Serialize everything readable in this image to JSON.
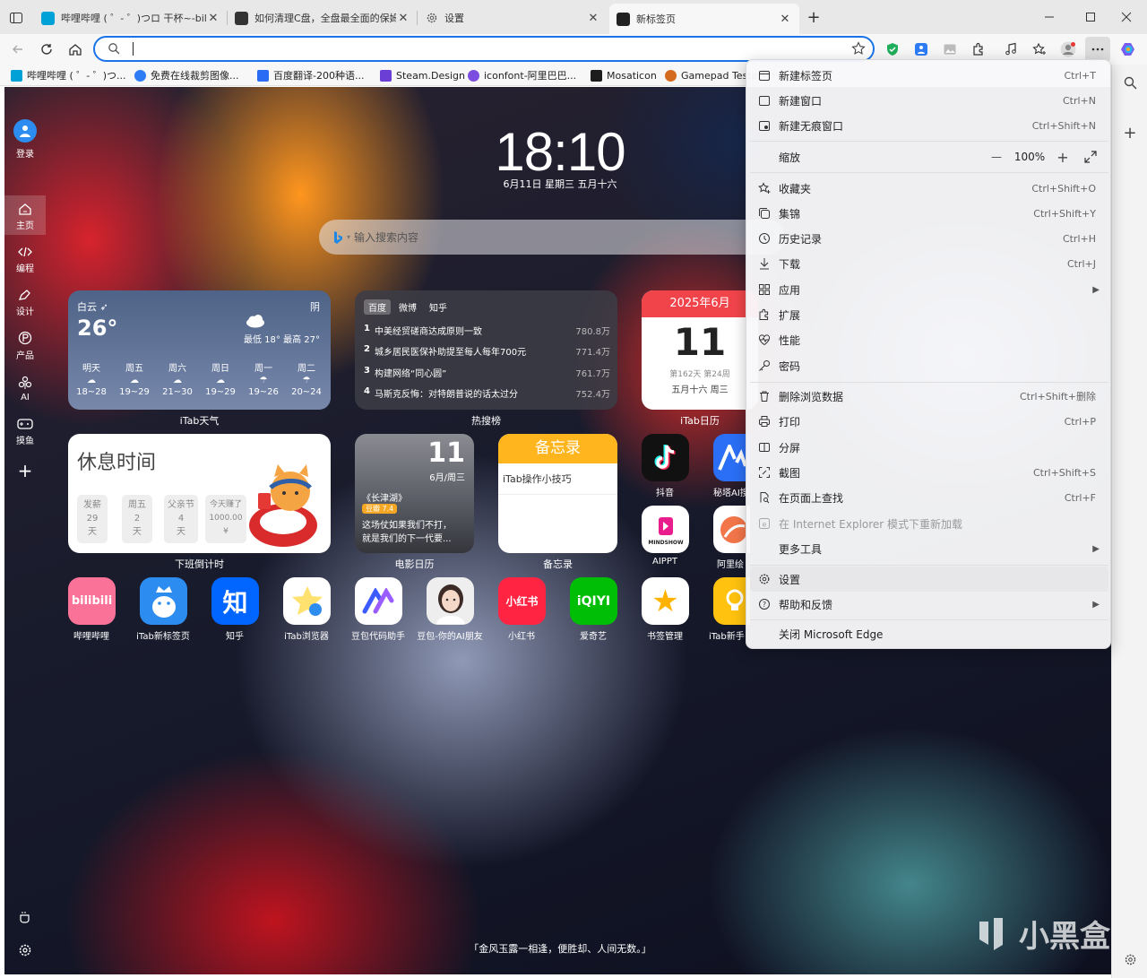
{
  "tabs": [
    {
      "title": "哔哩哔哩 ( ゜- ゜)つロ 干杯~-bilibili",
      "favicon_color": "#00a1d6"
    },
    {
      "title": "如何清理C盘，全盘最全面的保姆级",
      "favicon_color": "#333333"
    },
    {
      "title": "设置",
      "favicon_color": "#555555"
    },
    {
      "title": "新标签页",
      "favicon_color": "#222222"
    }
  ],
  "address_bar": {
    "value": ""
  },
  "bookmarks": [
    {
      "label": "哔哩哔哩 ( ゜- ゜)つ...",
      "color": "#00a1d6"
    },
    {
      "label": "免费在线裁剪图像...",
      "color": "#2d7cf6"
    },
    {
      "label": "百度翻译-200种语...",
      "color": "#2a6df4"
    },
    {
      "label": "Steam.Design",
      "color": "#6b3fd6"
    },
    {
      "label": "iconfont-阿里巴巴...",
      "color": "#7b4ee0"
    },
    {
      "label": "Mosaticon",
      "color": "#1d1d1d"
    },
    {
      "label": "Gamepad Teste",
      "color": "#d46a1e"
    }
  ],
  "sidebar": {
    "login": "登录",
    "items": [
      {
        "label": "主页",
        "icon": "home-icon"
      },
      {
        "label": "编程",
        "icon": "code-icon"
      },
      {
        "label": "设计",
        "icon": "pen-icon"
      },
      {
        "label": "产品",
        "icon": "p-icon"
      },
      {
        "label": "AI",
        "icon": "ai-icon"
      },
      {
        "label": "摸鱼",
        "icon": "gamepad-icon"
      }
    ]
  },
  "clock": {
    "time": "18:10",
    "date": "6月11日  星期三  五月十六"
  },
  "search": {
    "placeholder": "输入搜索内容"
  },
  "weather": {
    "city": "白云",
    "temp": "26°",
    "cond": "阴",
    "range": "最低 18° 最高 27°",
    "forecast": [
      {
        "day": "明天",
        "range": "18~28"
      },
      {
        "day": "周五",
        "range": "19~29"
      },
      {
        "day": "周六",
        "range": "21~30"
      },
      {
        "day": "周日",
        "range": "19~29"
      },
      {
        "day": "周一",
        "range": "19~26"
      },
      {
        "day": "周二",
        "range": "20~24"
      }
    ],
    "label": "iTab天气"
  },
  "hot": {
    "tabs": [
      "百度",
      "微博",
      "知乎"
    ],
    "items": [
      {
        "n": "1",
        "title": "中美经贸磋商达成原则一致",
        "value": "780.8万"
      },
      {
        "n": "2",
        "title": "城乡居民医保补助提至每人每年700元",
        "value": "771.4万"
      },
      {
        "n": "3",
        "title": "构建网络“同心圆”",
        "value": "761.7万"
      },
      {
        "n": "4",
        "title": "马斯克反悔：对特朗普说的话太过分",
        "value": "752.4万"
      }
    ],
    "label": "热搜榜"
  },
  "calendar": {
    "header": "2025年6月",
    "day": "11",
    "week": "第162天 第24周",
    "lunar": "五月十六 周三",
    "label": "iTab日历"
  },
  "countdown": {
    "title": "休息时间",
    "cells": [
      {
        "top": "发薪",
        "mid": "29",
        "bot": "天"
      },
      {
        "top": "周五",
        "mid": "2",
        "bot": "天"
      },
      {
        "top": "父亲节",
        "mid": "4",
        "bot": "天"
      },
      {
        "top": "今天赚了",
        "mid": "1000.00",
        "bot": "¥"
      }
    ],
    "label": "下班倒计时"
  },
  "movie": {
    "day": "11",
    "date": "6月/周三",
    "title": "《长津湖》",
    "score": "豆瓣 7.4",
    "desc1": "这场仗如果我们不打，",
    "desc2": "就是我们的下一代要...",
    "label": "电影日历"
  },
  "memo": {
    "header": "备忘录",
    "item": "iTab操作小技巧",
    "label": "备忘录"
  },
  "apps_right": [
    {
      "label": "抖音",
      "bg": "#111111"
    },
    {
      "label": "秘塔AI搜",
      "bg": "#2b6ff6"
    },
    {
      "label": "AIPPT",
      "bg": "#ffffff"
    },
    {
      "label": "阿里绘",
      "bg": "#ffffff"
    }
  ],
  "apps_bottom": [
    {
      "label": "哔哩哔哩",
      "bg": "#fb7299",
      "glyph": "bilibili"
    },
    {
      "label": "iTab新标签页",
      "bg": "#2d8cf0",
      "glyph": ""
    },
    {
      "label": "知乎",
      "bg": "#0066ff",
      "glyph": "知"
    },
    {
      "label": "iTab浏览器",
      "bg": "#ffffff",
      "glyph": ""
    },
    {
      "label": "豆包代码助手",
      "bg": "#ffffff",
      "glyph": ""
    },
    {
      "label": "豆包-你的AI朋友",
      "bg": "#eeeeee",
      "glyph": ""
    },
    {
      "label": "小红书",
      "bg": "#ff2442",
      "glyph": "小红书"
    },
    {
      "label": "爱奇艺",
      "bg": "#00be06",
      "glyph": "iQIYI"
    },
    {
      "label": "书签管理",
      "bg": "#ffffff",
      "glyph": "★"
    },
    {
      "label": "iTab新手",
      "bg": "#ffc20e",
      "glyph": ""
    }
  ],
  "quote": "「金风玉露一相逢，便胜却、人间无数。」",
  "watermark": "小黑盒",
  "menu": {
    "items": [
      {
        "label": "新建标签页",
        "shortcut": "Ctrl+T",
        "icon": "new-tab-icon"
      },
      {
        "label": "新建窗口",
        "shortcut": "Ctrl+N",
        "icon": "new-window-icon"
      },
      {
        "label": "新建无痕窗口",
        "shortcut": "Ctrl+Shift+N",
        "icon": "inprivate-icon"
      },
      {
        "label": "缩放",
        "shortcut": "",
        "icon": ""
      },
      {
        "label": "收藏夹",
        "shortcut": "Ctrl+Shift+O",
        "icon": "favorites-icon"
      },
      {
        "label": "集锦",
        "shortcut": "Ctrl+Shift+Y",
        "icon": "collections-icon"
      },
      {
        "label": "历史记录",
        "shortcut": "Ctrl+H",
        "icon": "history-icon"
      },
      {
        "label": "下载",
        "shortcut": "Ctrl+J",
        "icon": "download-icon"
      },
      {
        "label": "应用",
        "shortcut": "",
        "icon": "apps-icon"
      },
      {
        "label": "扩展",
        "shortcut": "",
        "icon": "extensions-icon"
      },
      {
        "label": "性能",
        "shortcut": "",
        "icon": "performance-icon"
      },
      {
        "label": "密码",
        "shortcut": "",
        "icon": "key-icon"
      },
      {
        "label": "删除浏览数据",
        "shortcut": "Ctrl+Shift+删除",
        "icon": "trash-icon"
      },
      {
        "label": "打印",
        "shortcut": "Ctrl+P",
        "icon": "print-icon"
      },
      {
        "label": "分屏",
        "shortcut": "",
        "icon": "split-icon"
      },
      {
        "label": "截图",
        "shortcut": "Ctrl+Shift+S",
        "icon": "screenshot-icon"
      },
      {
        "label": "在页面上查找",
        "shortcut": "Ctrl+F",
        "icon": "find-icon"
      },
      {
        "label": "在 Internet Explorer 模式下重新加载",
        "shortcut": "",
        "icon": "ie-icon"
      },
      {
        "label": "更多工具",
        "shortcut": "",
        "icon": ""
      },
      {
        "label": "设置",
        "shortcut": "",
        "icon": "settings-icon"
      },
      {
        "label": "帮助和反馈",
        "shortcut": "",
        "icon": "help-icon"
      },
      {
        "label": "关闭 Microsoft Edge",
        "shortcut": "",
        "icon": ""
      }
    ],
    "zoom": {
      "value": "100%",
      "minus": "—",
      "plus": "+"
    }
  }
}
